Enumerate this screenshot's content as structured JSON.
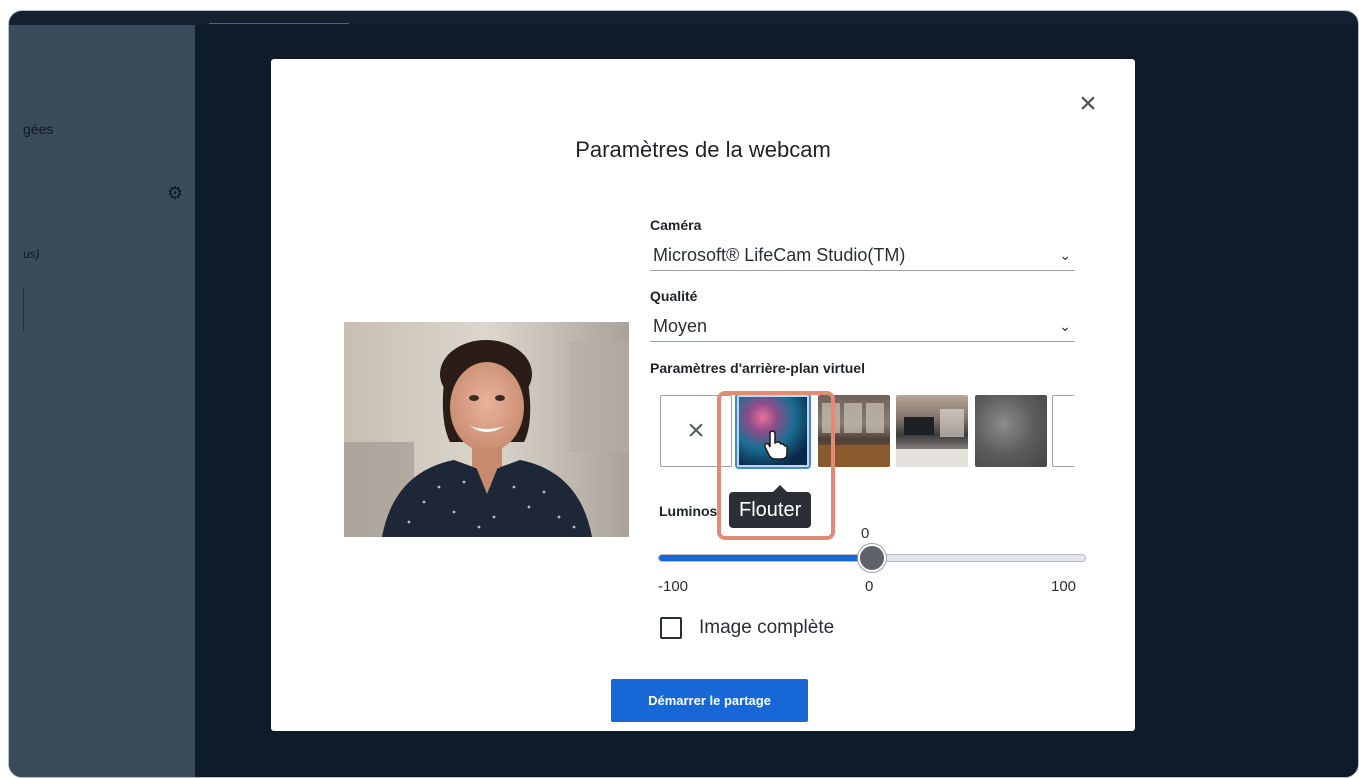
{
  "left_panel": {
    "text_1": "gées",
    "text_2": "us)"
  },
  "modal": {
    "title": "Paramètres de la webcam",
    "close_label": "×"
  },
  "camera": {
    "label": "Caméra",
    "value": "Microsoft® LifeCam Studio(TM)"
  },
  "quality": {
    "label": "Qualité",
    "value": "Moyen"
  },
  "background": {
    "label": "Paramètres d'arrière-plan virtuel",
    "none_icon": "close-icon",
    "tooltip": "Flouter",
    "selected": "Flouter"
  },
  "brightness": {
    "label": "Luminos",
    "value": "0",
    "min_label": "-100",
    "mid_label": "0",
    "max_label": "100",
    "level": 0.5
  },
  "full_image": {
    "label": "Image complète",
    "checked": false
  },
  "start_button": {
    "label": "Démarrer le partage"
  },
  "colors": {
    "accent": "#1767d6",
    "highlight": "#e08a78",
    "overlay": "#0e1b2a"
  }
}
